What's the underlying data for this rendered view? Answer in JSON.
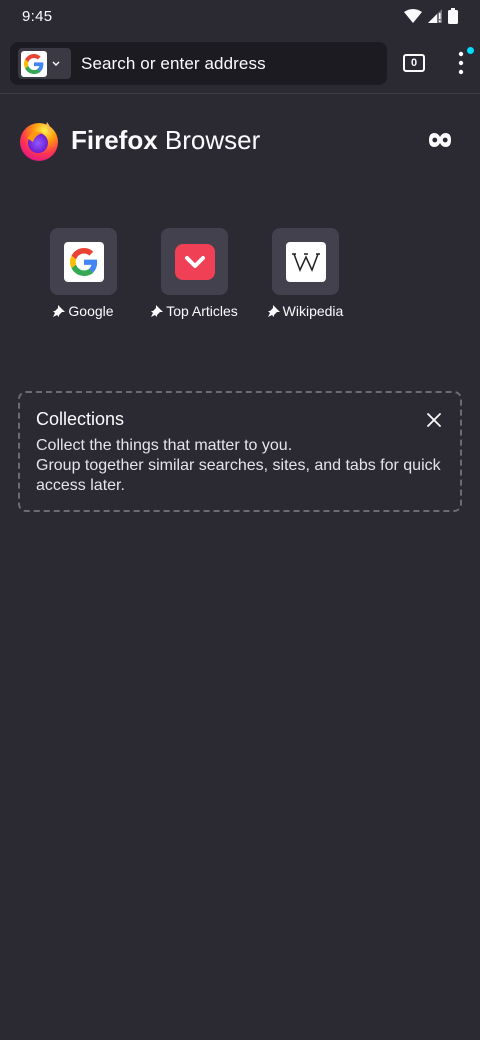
{
  "status_bar": {
    "time": "9:45"
  },
  "toolbar": {
    "search_engine": "Google",
    "url_placeholder": "Search or enter address",
    "tab_count": "0"
  },
  "brand": {
    "name_bold": "Firefox",
    "name_rest": " Browser"
  },
  "top_sites": [
    {
      "label": "Google",
      "icon": "google-logo"
    },
    {
      "label": "Top Articles",
      "icon": "pocket-logo"
    },
    {
      "label": "Wikipedia",
      "icon": "wikipedia-logo"
    }
  ],
  "collections": {
    "title": "Collections",
    "line1": "Collect the things that matter to you.",
    "line2": "Group together similar searches, sites, and tabs for quick access later."
  },
  "colors": {
    "background": "#2b2a33",
    "url_bar": "#1c1b22",
    "tile": "#42414d",
    "accent_dot": "#00ddff",
    "pocket": "#ef4056"
  }
}
